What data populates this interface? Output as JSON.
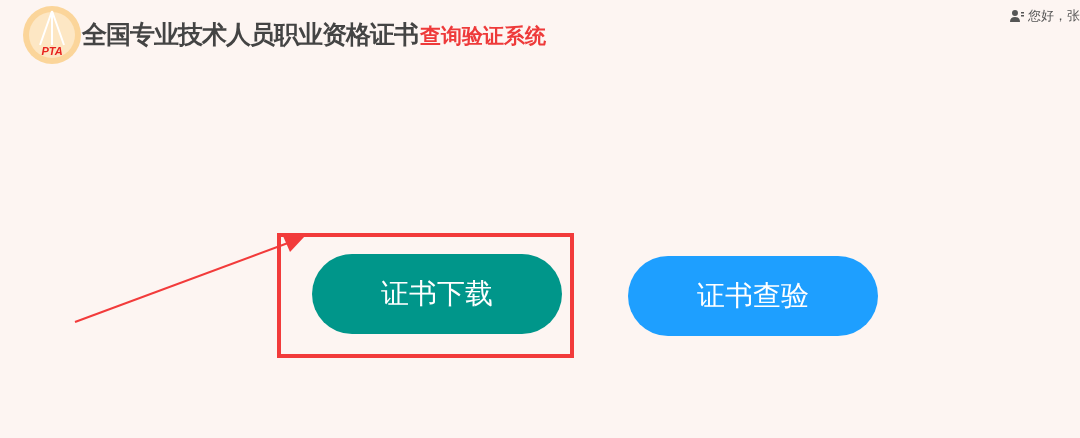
{
  "header": {
    "logo_text": "PTA",
    "title": "全国专业技术人员职业资格证书",
    "subtitle": "查询验证系统",
    "greeting": "您好，张"
  },
  "buttons": [
    {
      "label": "证书下载",
      "color": "#00968a",
      "highlighted": true
    },
    {
      "label": "证书查验",
      "color": "#1e9fff",
      "highlighted": false
    }
  ]
}
